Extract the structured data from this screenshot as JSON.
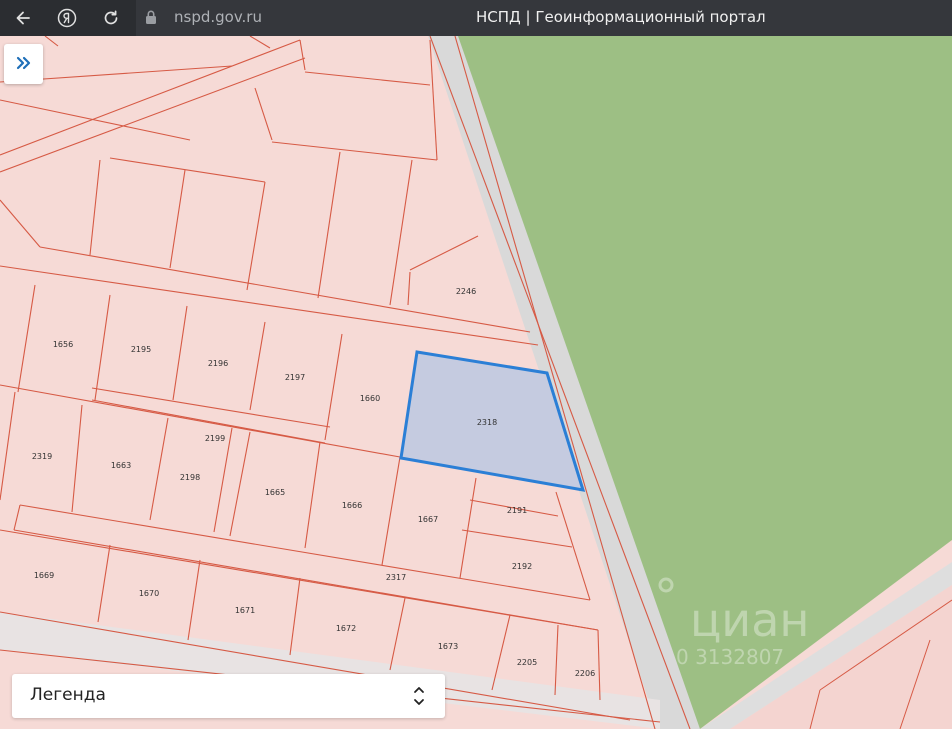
{
  "browser": {
    "url": "nspd.gov.ru",
    "title": "НСПД | Геоинформационный портал",
    "icons": {
      "back": "back-arrow-icon",
      "yandex": "yandex-logo-icon",
      "reload": "reload-icon",
      "lock": "lock-icon"
    }
  },
  "map": {
    "colors": {
      "parcel_fill": "#f6dad6",
      "parcel_border": "#d65a45",
      "forest": "#9dbf84",
      "road": "#d9d9d9",
      "selection": "#2b7fd6",
      "selection_fill": "#c5cbe0"
    },
    "selected_parcel": "2318",
    "parcels": {
      "p2246": "2246",
      "p1656": "1656",
      "p2195": "2195",
      "p2196": "2196",
      "p2197": "2197",
      "p1660": "1660",
      "p2318": "2318",
      "p2319": "2319",
      "p1663": "1663",
      "p2199": "2199",
      "p2198": "2198",
      "p1665": "1665",
      "p1666": "1666",
      "p1667": "1667",
      "p2191": "2191",
      "p2192": "2192",
      "p1669": "1669",
      "p2317": "2317",
      "p1670": "1670",
      "p1671": "1671",
      "p1672": "1672",
      "p1673": "1673",
      "p2205": "2205",
      "p2206": "2206"
    },
    "watermark": {
      "brand": "циан",
      "number": "0 3132807"
    }
  },
  "controls": {
    "expand_icon": "double-chevron-right-icon",
    "legend_label": "Легенда",
    "legend_icon": "updown-chevron-icon"
  }
}
